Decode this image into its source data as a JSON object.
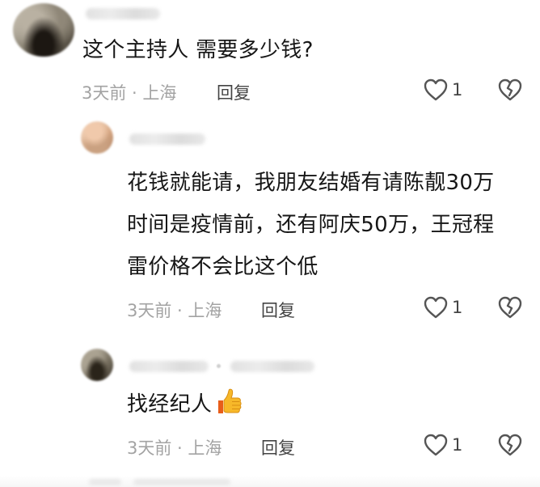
{
  "comments": [
    {
      "text": "这个主持人 需要多少钱?",
      "meta": "3天前 · 上海",
      "reply_label": "回复",
      "likes": "1",
      "avatar_icon": "blurred-avatar",
      "username_blurred": true
    },
    {
      "text": "花钱就能请，我朋友结婚有请陈靓30万时间是疫情前，还有阿庆50万，王冠程雷价格不会比这个低",
      "meta": "3天前 · 上海",
      "reply_label": "回复",
      "likes": "1",
      "avatar_icon": "blurred-avatar",
      "username_blurred": true
    },
    {
      "text": "找经纪人",
      "emoji": "thumbs-up-emoji",
      "meta": "3天前 · 上海",
      "reply_label": "回复",
      "likes": "1",
      "avatar_icon": "blurred-avatar",
      "username_blurred": true
    }
  ],
  "icons": {
    "like": "heart-outline-icon",
    "dislike": "broken-heart-icon"
  },
  "colors": {
    "text": "#161616",
    "meta": "#a3a3a3",
    "action": "#444444",
    "background": "#ffffff"
  }
}
